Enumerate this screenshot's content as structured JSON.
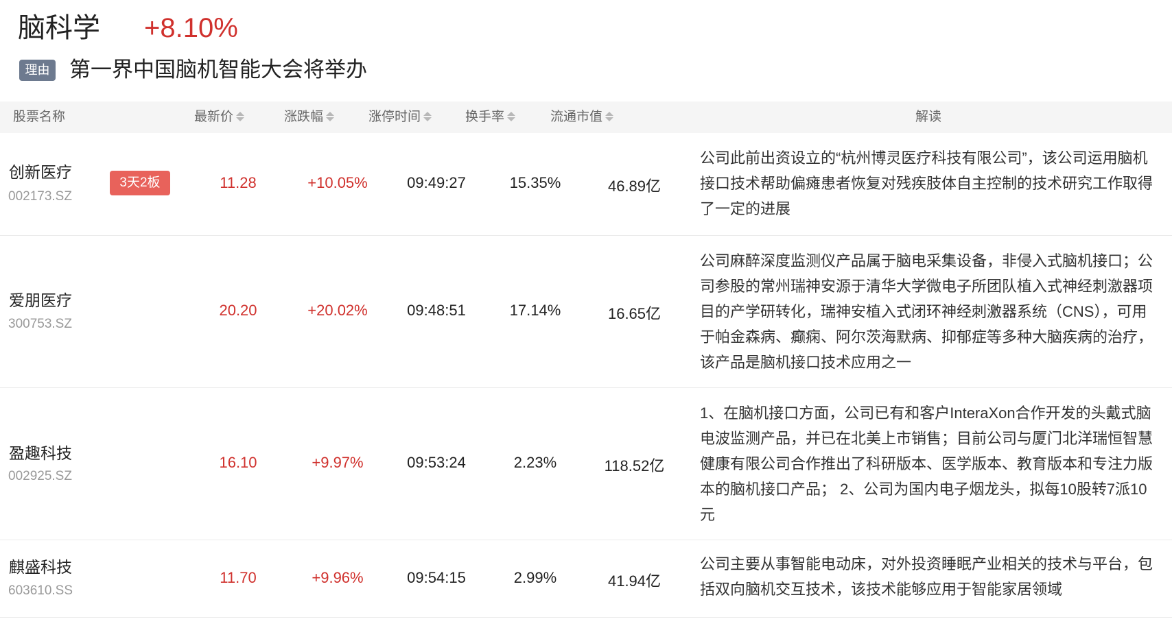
{
  "sector": {
    "name": "脑科学",
    "change": "+8.10%",
    "reason_tag": "理由",
    "reason_text": "第一界中国脑机智能大会将举办"
  },
  "table": {
    "headers": {
      "name": "股票名称",
      "price": "最新价",
      "change": "涨跌幅",
      "limit_time": "涨停时间",
      "turnover": "换手率",
      "market_cap": "流通市值",
      "analysis": "解读"
    },
    "rows": [
      {
        "name": "创新医疗",
        "code": "002173.SZ",
        "badge": "3天2板",
        "price": "11.28",
        "change": "+10.05%",
        "limit_time": "09:49:27",
        "turnover": "15.35%",
        "market_cap": "46.89亿",
        "analysis": "公司此前出资设立的“杭州博灵医疗科技有限公司”，该公司运用脑机接口技术帮助偏瘫患者恢复对残疾肢体自主控制的技术研究工作取得了一定的进展"
      },
      {
        "name": "爱朋医疗",
        "code": "300753.SZ",
        "badge": "",
        "price": "20.20",
        "change": "+20.02%",
        "limit_time": "09:48:51",
        "turnover": "17.14%",
        "market_cap": "16.65亿",
        "analysis": "公司麻醉深度监测仪产品属于脑电采集设备，非侵入式脑机接口；公司参股的常州瑞神安源于清华大学微电子所团队植入式神经刺激器项目的产学研转化，瑞神安植入式闭环神经刺激器系统（CNS），可用于帕金森病、癫痫、阿尔茨海默病、抑郁症等多种大脑疾病的治疗，该产品是脑机接口技术应用之一"
      },
      {
        "name": "盈趣科技",
        "code": "002925.SZ",
        "badge": "",
        "price": "16.10",
        "change": "+9.97%",
        "limit_time": "09:53:24",
        "turnover": "2.23%",
        "market_cap": "118.52亿",
        "analysis": "1、在脑机接口方面，公司已有和客户InteraXon合作开发的头戴式脑电波监测产品，并已在北美上市销售；目前公司与厦门北洋瑞恒智慧健康有限公司合作推出了科研版本、医学版本、教育版本和专注力版本的脑机接口产品； 2、公司为国内电子烟龙头，拟每10股转7派10元"
      },
      {
        "name": "麒盛科技",
        "code": "603610.SS",
        "badge": "",
        "price": "11.70",
        "change": "+9.96%",
        "limit_time": "09:54:15",
        "turnover": "2.99%",
        "market_cap": "41.94亿",
        "analysis": "公司主要从事智能电动床，对外投资睡眠产业相关的技术与平台，包括双向脑机交互技术，该技术能够应用于智能家居领域"
      }
    ]
  },
  "colors": {
    "up": "#d0312d",
    "badge": "#e8625b",
    "reason_tag_bg": "#6d7a8f",
    "header_bg": "#f5f5f5"
  }
}
